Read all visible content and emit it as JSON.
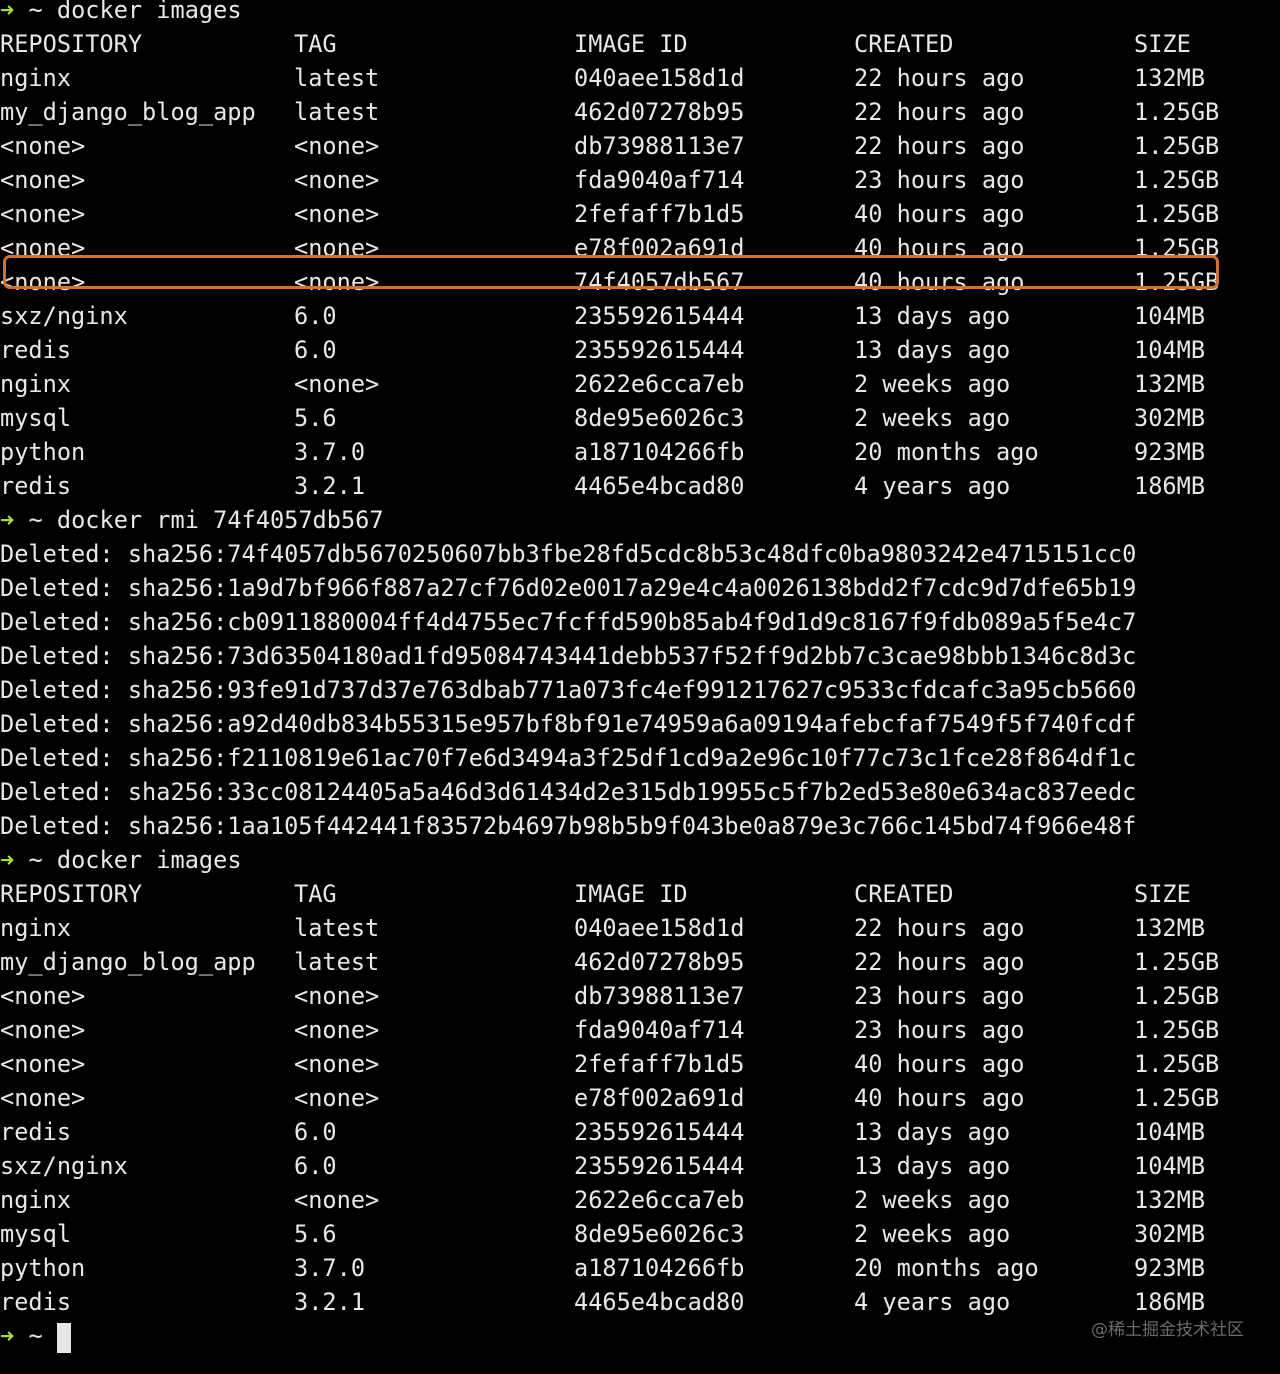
{
  "terminal": {
    "prompt_symbol": "➜",
    "prompt_tilde": "~",
    "prompt_color": "#a6e22e",
    "highlight_color": "#d2712b",
    "commands": [
      "docker images",
      "docker rmi 74f4057db567",
      "docker images"
    ],
    "images_header": [
      "REPOSITORY",
      "TAG",
      "IMAGE ID",
      "CREATED",
      "SIZE"
    ],
    "images_before": [
      [
        "nginx",
        "latest",
        "040aee158d1d",
        "22 hours ago",
        "132MB"
      ],
      [
        "my_django_blog_app",
        "latest",
        "462d07278b95",
        "22 hours ago",
        "1.25GB"
      ],
      [
        "<none>",
        "<none>",
        "db73988113e7",
        "22 hours ago",
        "1.25GB"
      ],
      [
        "<none>",
        "<none>",
        "fda9040af714",
        "23 hours ago",
        "1.25GB"
      ],
      [
        "<none>",
        "<none>",
        "2fefaff7b1d5",
        "40 hours ago",
        "1.25GB"
      ],
      [
        "<none>",
        "<none>",
        "e78f002a691d",
        "40 hours ago",
        "1.25GB"
      ],
      [
        "<none>",
        "<none>",
        "74f4057db567",
        "40 hours ago",
        "1.25GB"
      ],
      [
        "sxz/nginx",
        "6.0",
        "235592615444",
        "13 days ago",
        "104MB"
      ],
      [
        "redis",
        "6.0",
        "235592615444",
        "13 days ago",
        "104MB"
      ],
      [
        "nginx",
        "<none>",
        "2622e6cca7eb",
        "2 weeks ago",
        "132MB"
      ],
      [
        "mysql",
        "5.6",
        "8de95e6026c3",
        "2 weeks ago",
        "302MB"
      ],
      [
        "python",
        "3.7.0",
        "a187104266fb",
        "20 months ago",
        "923MB"
      ],
      [
        "redis",
        "3.2.1",
        "4465e4bcad80",
        "4 years ago",
        "186MB"
      ]
    ],
    "deleted_lines": [
      "Deleted: sha256:74f4057db5670250607bb3fbe28fd5cdc8b53c48dfc0ba9803242e4715151cc0",
      "Deleted: sha256:1a9d7bf966f887a27cf76d02e0017a29e4c4a0026138bdd2f7cdc9d7dfe65b19",
      "Deleted: sha256:cb0911880004ff4d4755ec7fcffd590b85ab4f9d1d9c8167f9fdb089a5f5e4c7",
      "Deleted: sha256:73d63504180ad1fd95084743441debb537f52ff9d2bb7c3cae98bbb1346c8d3c",
      "Deleted: sha256:93fe91d737d37e763dbab771a073fc4ef991217627c9533cfdcafc3a95cb5660",
      "Deleted: sha256:a92d40db834b55315e957bf8bf91e74959a6a09194afebcfaf7549f5f740fcdf",
      "Deleted: sha256:f2110819e61ac70f7e6d3494a3f25df1cd9a2e96c10f77c73c1fce28f864df1c",
      "Deleted: sha256:33cc08124405a5a46d3d61434d2e315db19955c5f7b2ed53e80e634ac837eedc",
      "Deleted: sha256:1aa105f442441f83572b4697b98b5b9f043be0a879e3c766c145bd74f966e48f"
    ],
    "images_after": [
      [
        "nginx",
        "latest",
        "040aee158d1d",
        "22 hours ago",
        "132MB"
      ],
      [
        "my_django_blog_app",
        "latest",
        "462d07278b95",
        "22 hours ago",
        "1.25GB"
      ],
      [
        "<none>",
        "<none>",
        "db73988113e7",
        "23 hours ago",
        "1.25GB"
      ],
      [
        "<none>",
        "<none>",
        "fda9040af714",
        "23 hours ago",
        "1.25GB"
      ],
      [
        "<none>",
        "<none>",
        "2fefaff7b1d5",
        "40 hours ago",
        "1.25GB"
      ],
      [
        "<none>",
        "<none>",
        "e78f002a691d",
        "40 hours ago",
        "1.25GB"
      ],
      [
        "redis",
        "6.0",
        "235592615444",
        "13 days ago",
        "104MB"
      ],
      [
        "sxz/nginx",
        "6.0",
        "235592615444",
        "13 days ago",
        "104MB"
      ],
      [
        "nginx",
        "<none>",
        "2622e6cca7eb",
        "2 weeks ago",
        "132MB"
      ],
      [
        "mysql",
        "5.6",
        "8de95e6026c3",
        "2 weeks ago",
        "302MB"
      ],
      [
        "python",
        "3.7.0",
        "a187104266fb",
        "20 months ago",
        "923MB"
      ],
      [
        "redis",
        "3.2.1",
        "4465e4bcad80",
        "4 years ago",
        "186MB"
      ]
    ]
  },
  "watermark": "@稀土掘金技术社区"
}
